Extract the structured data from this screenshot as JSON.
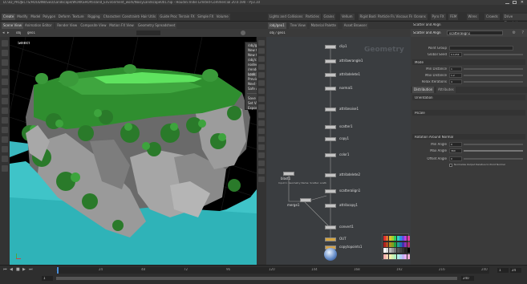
{
  "app": {
    "title": "D:/3D_PROJECTS/HOUDINI/GEO/Landscape/WORKSHOP/island_Environment_work/NoisyLandscape001.hip - Houdini Indie Limited-Commercial 20.0.590 - Py3.10"
  },
  "menu": [
    "File",
    "Edit",
    "Render",
    "Assets",
    "Windows",
    "Help",
    "Build",
    "Workspace",
    "Main",
    "Build",
    "Desktop"
  ],
  "shelf_tabs": [
    "Create",
    "Modify",
    "Model",
    "Polygon",
    "Deform",
    "Texture",
    "Rigging",
    "Characters",
    "Constraints",
    "Hair Utils",
    "Guide Process",
    "Terrain FX",
    "Simple FX",
    "Volume"
  ],
  "shelf2_tabs": [
    "Lights and Cameras",
    "Collisions",
    "Particles",
    "Grains",
    "Vellum",
    "Rigid Bodies",
    "Particle Fluids",
    "Viscous Fluids",
    "Oceans",
    "Pyro FX",
    "FEM",
    "Wires",
    "Crowds",
    "Drive Simulation"
  ],
  "viewport": {
    "tabs": [
      "Scene View",
      "Animation Editor",
      "Render View",
      "Composite View",
      "Motion FX View",
      "Geometry Spreadsheet"
    ],
    "toolbar_obj": "obj",
    "toolbar_geo": "geo1",
    "select_label": "Select",
    "camera_label": "Persp",
    "noCam": "No cam"
  },
  "camera_menu": {
    "items": [
      "/obj/geo1/render_cam/ OBJ/camera1_geo/render/cam/Main",
      "New Camera",
      "New Camera",
      "/obj/camera1_cam/render/scene_cam",
      "nodeone_cam",
      "/render/cam/OBJ/camera1_geo/render/cam/Main",
      "Look Through Light",
      "Previous Camera",
      "Next Camera",
      "Safe Areas for Camera",
      "",
      "Save View",
      "Set View From Camera (Split)",
      "Export View to Camera Node"
    ]
  },
  "network": {
    "tabs": [
      "/obj/geo1",
      "Tree View",
      "Material Palette",
      "Asset Browser"
    ],
    "path": "obj / geo1",
    "menu": [
      "Add",
      "Edit",
      "Go",
      "View",
      "Tools",
      "Layout",
      "Labs",
      "Help"
    ],
    "watermark": "Geometry",
    "nodes": [
      {
        "label": "clip1"
      },
      {
        "label": "attribwrangle1"
      },
      {
        "label": "attribdelete1"
      },
      {
        "label": "normal1"
      },
      {
        "label": "attribnoise1"
      },
      {
        "label": "scatter1"
      },
      {
        "label": "copy1"
      },
      {
        "label": "color1"
      },
      {
        "label": "attribdelete2"
      },
      {
        "label": "scatteralign1"
      },
      {
        "label": "attribcopy1"
      },
      {
        "label": "convert1"
      },
      {
        "label": "OUT"
      },
      {
        "label": "copytopoints1"
      },
      {
        "label": "sphere1"
      }
    ],
    "side_labels": [
      "blast1",
      "merge1",
      "xform1",
      "sort1",
      "grid_extra"
    ],
    "info_text": "Input 1: Geometry Name: Scatter: scatter1 Points: 20,000"
  },
  "params": {
    "node_type": "Scatter and Align",
    "node_name": "scatteralign1",
    "rows": [
      {
        "label": "Point Group",
        "value": ""
      },
      {
        "label": "Global Seed",
        "value": "0.1234"
      },
      {
        "label": "Mode",
        "value": ""
      },
      {
        "label": "Min Distance",
        "value": "1"
      },
      {
        "label": "Max Distance",
        "value": "1.2"
      },
      {
        "label": "Relax Iterations",
        "value": "4"
      }
    ],
    "tabs": [
      "Distribution",
      "Attributes"
    ],
    "sections": [
      "Orientation",
      "Pscale",
      "Rotation Around Normal"
    ],
    "ranges": [
      {
        "label": "Min Angle",
        "value": "0"
      },
      {
        "label": "Max Angle",
        "value": "360"
      },
      {
        "label": "Offset Angle",
        "value": "0"
      }
    ],
    "checkbox_label": "Normalize Output Relative to Point Normal",
    "mode_label": "Min Distance",
    "use_point_groups": "Use Density Attribute"
  },
  "timeline": {
    "start": "1",
    "end": "240",
    "current": "1",
    "ticks": [
      "1",
      "24",
      "48",
      "72",
      "96",
      "120",
      "144",
      "168",
      "192",
      "216",
      "240"
    ],
    "fps": "24"
  },
  "palette_colors": [
    "#e03030",
    "#e07030",
    "#e0c030",
    "#a0d030",
    "#30d060",
    "#30d0c0",
    "#3090e0",
    "#6050e0",
    "#c040e0",
    "#e040a0",
    "#b02020",
    "#b05020",
    "#b09020",
    "#80a020",
    "#20a040",
    "#20a090",
    "#2070b0",
    "#4030b0",
    "#9030b0",
    "#b03070",
    "#ffffff",
    "#dddddd",
    "#bbbbbb",
    "#999999",
    "#777777",
    "#555555",
    "#444444",
    "#333333",
    "#222222",
    "#000000",
    "#f4b0b0",
    "#f4d0b0",
    "#f4f0b0",
    "#d0f0b0",
    "#b0f0c0",
    "#b0f0e8",
    "#b0d0f4",
    "#c0b0f4",
    "#e8b0f4",
    "#f4b0d8"
  ]
}
